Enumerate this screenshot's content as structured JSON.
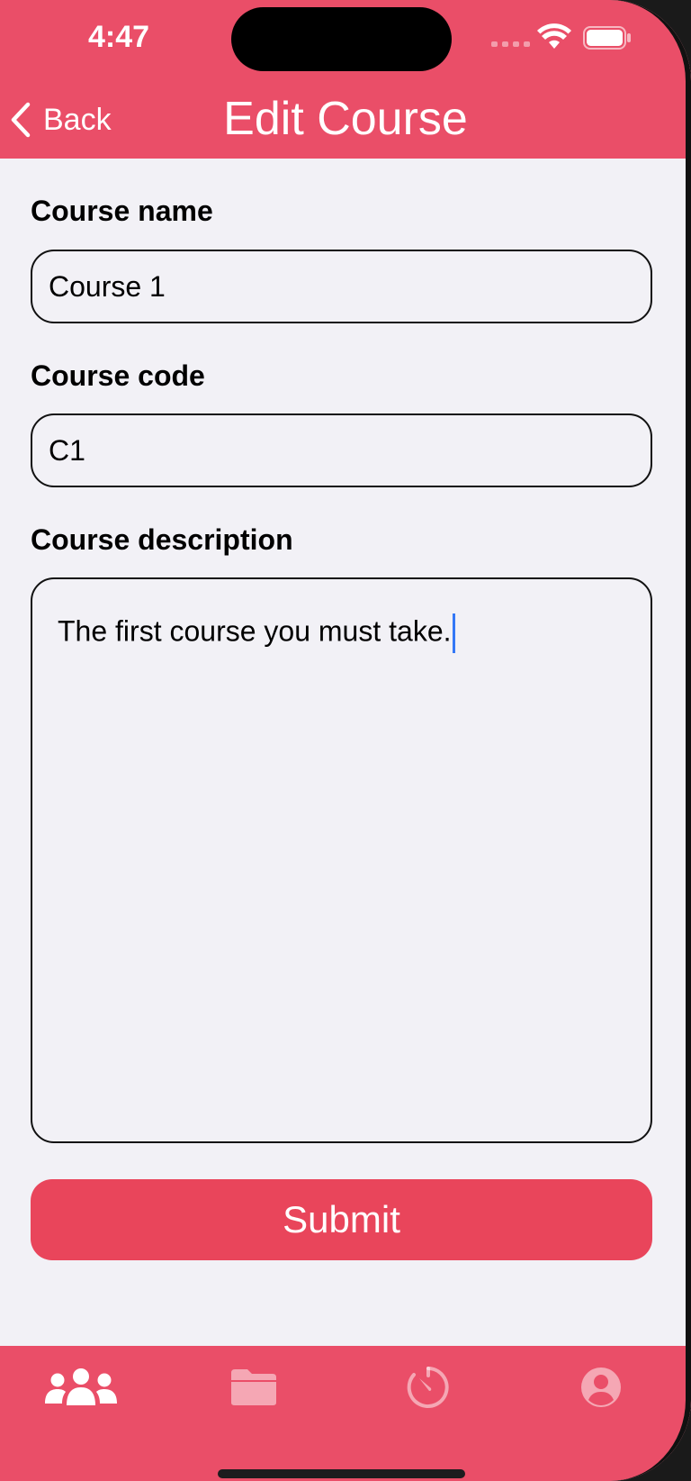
{
  "status_bar": {
    "time": "4:47"
  },
  "nav": {
    "back_label": "Back",
    "title": "Edit Course"
  },
  "form": {
    "course_name": {
      "label": "Course name",
      "value": "Course 1"
    },
    "course_code": {
      "label": "Course code",
      "value": "C1"
    },
    "course_description": {
      "label": "Course description",
      "value": "The first course you must take."
    },
    "submit_label": "Submit"
  },
  "tab_bar": {
    "items": [
      {
        "icon": "people-icon",
        "active": true
      },
      {
        "icon": "folder-icon",
        "active": false
      },
      {
        "icon": "timer-icon",
        "active": false
      },
      {
        "icon": "profile-icon",
        "active": false
      }
    ]
  },
  "colors": {
    "accent": "#ea4e68",
    "submit": "#e9455b",
    "background": "#f2f1f6",
    "cursor": "#3478f6"
  }
}
